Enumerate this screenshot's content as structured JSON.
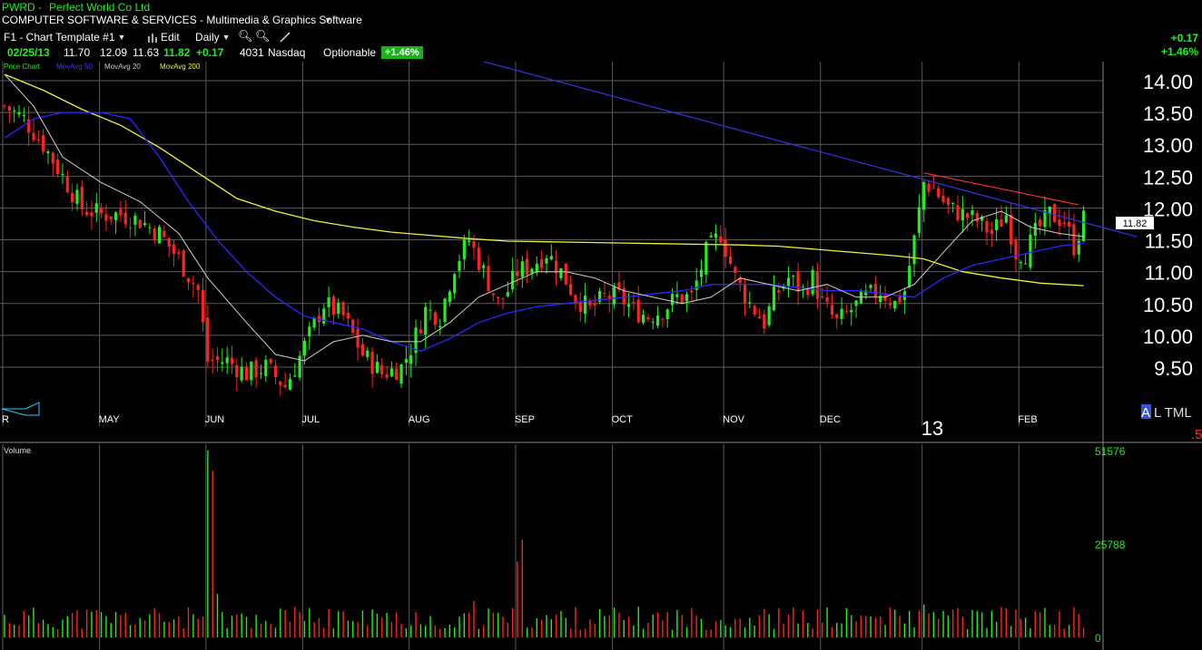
{
  "header": {
    "ticker": "PWRD",
    "company": "Perfect World Co Ltd",
    "industry": "COMPUTER SOFTWARE & SERVICES - Multimedia & Graphics Software",
    "template": "F1 - Chart Template #1",
    "edit_label": "Edit",
    "period": "Daily"
  },
  "quote": {
    "date": "02/25/13",
    "open": "11.70",
    "high": "12.09",
    "low": "11.63",
    "last": "11.82",
    "change": "+0.17",
    "volume_k": "4031",
    "exchange": "Nasdaq",
    "optionable": "Optionable",
    "pct_change": "+1.46%"
  },
  "change_top": {
    "abs": "+0.17",
    "pct": "+1.46%"
  },
  "legend": {
    "price": "Price Chart",
    "ma50": "MovAvg 50",
    "ma20": "MovAvg 20",
    "ma200": "MovAvg 200"
  },
  "price_axis": {
    "ticks": [
      "14.00",
      "13.50",
      "13.00",
      "12.50",
      "12.00",
      "11.50",
      "11.00",
      "10.50",
      "10.00",
      "9.50"
    ],
    "last_tag": "11.82"
  },
  "months": [
    {
      "label": "R",
      "day": 0
    },
    {
      "label": "MAY",
      "day": 20
    },
    {
      "label": "JUN",
      "day": 42
    },
    {
      "label": "JUL",
      "day": 62
    },
    {
      "label": "AUG",
      "day": 84
    },
    {
      "label": "SEP",
      "day": 106
    },
    {
      "label": "OCT",
      "day": 126
    },
    {
      "label": "NOV",
      "day": 149
    },
    {
      "label": "DEC",
      "day": 169
    },
    {
      "label": "13",
      "day": 190
    },
    {
      "label": "FEB",
      "day": 210
    }
  ],
  "volume_panel": {
    "label": "Volume",
    "ticks": [
      "51576",
      "25788",
      "0"
    ]
  },
  "right_tools": {
    "a": "A",
    "ltml": "L TML",
    "five": ".5"
  },
  "colors": {
    "up": "#22ee22",
    "down": "#ff2222",
    "ma20": "#d0d0c0",
    "ma50": "#2828ff",
    "ma200": "#f0f03c",
    "trend_blue": "#3333ee",
    "trend_red": "#ff3030",
    "grid": "#5a5a5a"
  },
  "chart_data": {
    "type": "candlestick",
    "price_range": [
      9.2,
      14.2
    ],
    "ohlc_anchors": [
      [
        0,
        13.6
      ],
      [
        4,
        13.4
      ],
      [
        8,
        13.0
      ],
      [
        12,
        12.5
      ],
      [
        16,
        12.0
      ],
      [
        20,
        11.9
      ],
      [
        24,
        11.9
      ],
      [
        28,
        11.8
      ],
      [
        32,
        11.6
      ],
      [
        36,
        11.2
      ],
      [
        40,
        10.7
      ],
      [
        42,
        9.6
      ],
      [
        46,
        9.6
      ],
      [
        50,
        9.4
      ],
      [
        54,
        9.5
      ],
      [
        58,
        9.2
      ],
      [
        60,
        9.5
      ],
      [
        63,
        10.0
      ],
      [
        66,
        10.5
      ],
      [
        70,
        10.3
      ],
      [
        74,
        9.7
      ],
      [
        78,
        9.4
      ],
      [
        82,
        9.5
      ],
      [
        84,
        9.8
      ],
      [
        87,
        10.4
      ],
      [
        90,
        10.3
      ],
      [
        93,
        11.1
      ],
      [
        96,
        11.5
      ],
      [
        99,
        11.0
      ],
      [
        102,
        10.5
      ],
      [
        104,
        10.7
      ],
      [
        106,
        11.0
      ],
      [
        109,
        11.1
      ],
      [
        112,
        11.3
      ],
      [
        115,
        11.0
      ],
      [
        118,
        10.6
      ],
      [
        121,
        10.4
      ],
      [
        124,
        10.6
      ],
      [
        127,
        10.6
      ],
      [
        130,
        10.4
      ],
      [
        133,
        10.3
      ],
      [
        136,
        10.4
      ],
      [
        139,
        10.6
      ],
      [
        142,
        10.6
      ],
      [
        145,
        11.3
      ],
      [
        148,
        11.6
      ],
      [
        151,
        10.9
      ],
      [
        154,
        10.5
      ],
      [
        157,
        10.2
      ],
      [
        159,
        10.6
      ],
      [
        162,
        10.9
      ],
      [
        165,
        10.7
      ],
      [
        167,
        10.9
      ],
      [
        169,
        10.5
      ],
      [
        172,
        10.2
      ],
      [
        175,
        10.4
      ],
      [
        178,
        10.6
      ],
      [
        181,
        10.7
      ],
      [
        184,
        10.5
      ],
      [
        186,
        10.7
      ],
      [
        188,
        11.5
      ],
      [
        190,
        12.4
      ],
      [
        192,
        12.3
      ],
      [
        195,
        12.0
      ],
      [
        198,
        11.9
      ],
      [
        201,
        11.8
      ],
      [
        204,
        11.6
      ],
      [
        207,
        11.9
      ],
      [
        209,
        11.3
      ],
      [
        211,
        11.3
      ],
      [
        213,
        11.6
      ],
      [
        216,
        11.9
      ],
      [
        219,
        11.8
      ],
      [
        221,
        11.4
      ],
      [
        223,
        11.82
      ]
    ],
    "ma20": [
      [
        0,
        14.1
      ],
      [
        6,
        13.6
      ],
      [
        12,
        12.8
      ],
      [
        20,
        12.4
      ],
      [
        28,
        12.1
      ],
      [
        36,
        11.6
      ],
      [
        42,
        10.9
      ],
      [
        50,
        10.2
      ],
      [
        56,
        9.7
      ],
      [
        62,
        9.6
      ],
      [
        68,
        9.9
      ],
      [
        74,
        10.0
      ],
      [
        80,
        9.9
      ],
      [
        86,
        9.9
      ],
      [
        92,
        10.2
      ],
      [
        98,
        10.6
      ],
      [
        104,
        10.8
      ],
      [
        110,
        11.0
      ],
      [
        116,
        11.0
      ],
      [
        122,
        10.9
      ],
      [
        128,
        10.7
      ],
      [
        134,
        10.6
      ],
      [
        140,
        10.5
      ],
      [
        146,
        10.6
      ],
      [
        152,
        10.9
      ],
      [
        158,
        10.8
      ],
      [
        164,
        10.7
      ],
      [
        170,
        10.8
      ],
      [
        176,
        10.6
      ],
      [
        182,
        10.6
      ],
      [
        188,
        10.8
      ],
      [
        194,
        11.3
      ],
      [
        200,
        11.8
      ],
      [
        206,
        11.95
      ],
      [
        212,
        11.7
      ],
      [
        218,
        11.6
      ],
      [
        223,
        11.55
      ]
    ],
    "ma50": [
      [
        0,
        13.1
      ],
      [
        6,
        13.4
      ],
      [
        12,
        13.5
      ],
      [
        20,
        13.5
      ],
      [
        26,
        13.4
      ],
      [
        32,
        12.8
      ],
      [
        38,
        12.1
      ],
      [
        44,
        11.5
      ],
      [
        50,
        11.0
      ],
      [
        56,
        10.6
      ],
      [
        62,
        10.3
      ],
      [
        68,
        10.2
      ],
      [
        74,
        10.1
      ],
      [
        80,
        9.9
      ],
      [
        86,
        9.75
      ],
      [
        92,
        9.95
      ],
      [
        98,
        10.2
      ],
      [
        104,
        10.35
      ],
      [
        110,
        10.45
      ],
      [
        116,
        10.5
      ],
      [
        122,
        10.55
      ],
      [
        128,
        10.6
      ],
      [
        134,
        10.65
      ],
      [
        140,
        10.7
      ],
      [
        146,
        10.8
      ],
      [
        152,
        10.8
      ],
      [
        158,
        10.8
      ],
      [
        164,
        10.75
      ],
      [
        170,
        10.7
      ],
      [
        176,
        10.7
      ],
      [
        182,
        10.65
      ],
      [
        188,
        10.6
      ],
      [
        194,
        10.9
      ],
      [
        200,
        11.1
      ],
      [
        206,
        11.2
      ],
      [
        212,
        11.3
      ],
      [
        218,
        11.4
      ],
      [
        223,
        11.45
      ]
    ],
    "ma200": [
      [
        0,
        14.1
      ],
      [
        8,
        13.85
      ],
      [
        16,
        13.55
      ],
      [
        24,
        13.3
      ],
      [
        32,
        12.95
      ],
      [
        40,
        12.55
      ],
      [
        48,
        12.15
      ],
      [
        56,
        11.95
      ],
      [
        64,
        11.8
      ],
      [
        72,
        11.7
      ],
      [
        80,
        11.62
      ],
      [
        88,
        11.57
      ],
      [
        96,
        11.52
      ],
      [
        104,
        11.48
      ],
      [
        112,
        11.47
      ],
      [
        120,
        11.46
      ],
      [
        128,
        11.45
      ],
      [
        136,
        11.44
      ],
      [
        144,
        11.43
      ],
      [
        152,
        11.42
      ],
      [
        160,
        11.4
      ],
      [
        168,
        11.35
      ],
      [
        176,
        11.3
      ],
      [
        184,
        11.25
      ],
      [
        190,
        11.2
      ],
      [
        198,
        11.0
      ],
      [
        206,
        10.9
      ],
      [
        214,
        10.82
      ],
      [
        223,
        10.78
      ]
    ],
    "trendlines": [
      {
        "name": "blue",
        "from": [
          99,
          14.3
        ],
        "to": [
          234,
          11.55
        ]
      },
      {
        "name": "red",
        "from": [
          190,
          12.55
        ],
        "to": [
          222,
          12.05
        ]
      }
    ],
    "volume_spikes": [
      [
        42,
        51576
      ],
      [
        43,
        46000
      ],
      [
        44,
        12000
      ],
      [
        106,
        21000
      ],
      [
        107,
        27000
      ],
      [
        97,
        10000
      ],
      [
        190,
        9000
      ],
      [
        195,
        6000
      ]
    ],
    "volume_range": [
      0,
      51576
    ]
  }
}
